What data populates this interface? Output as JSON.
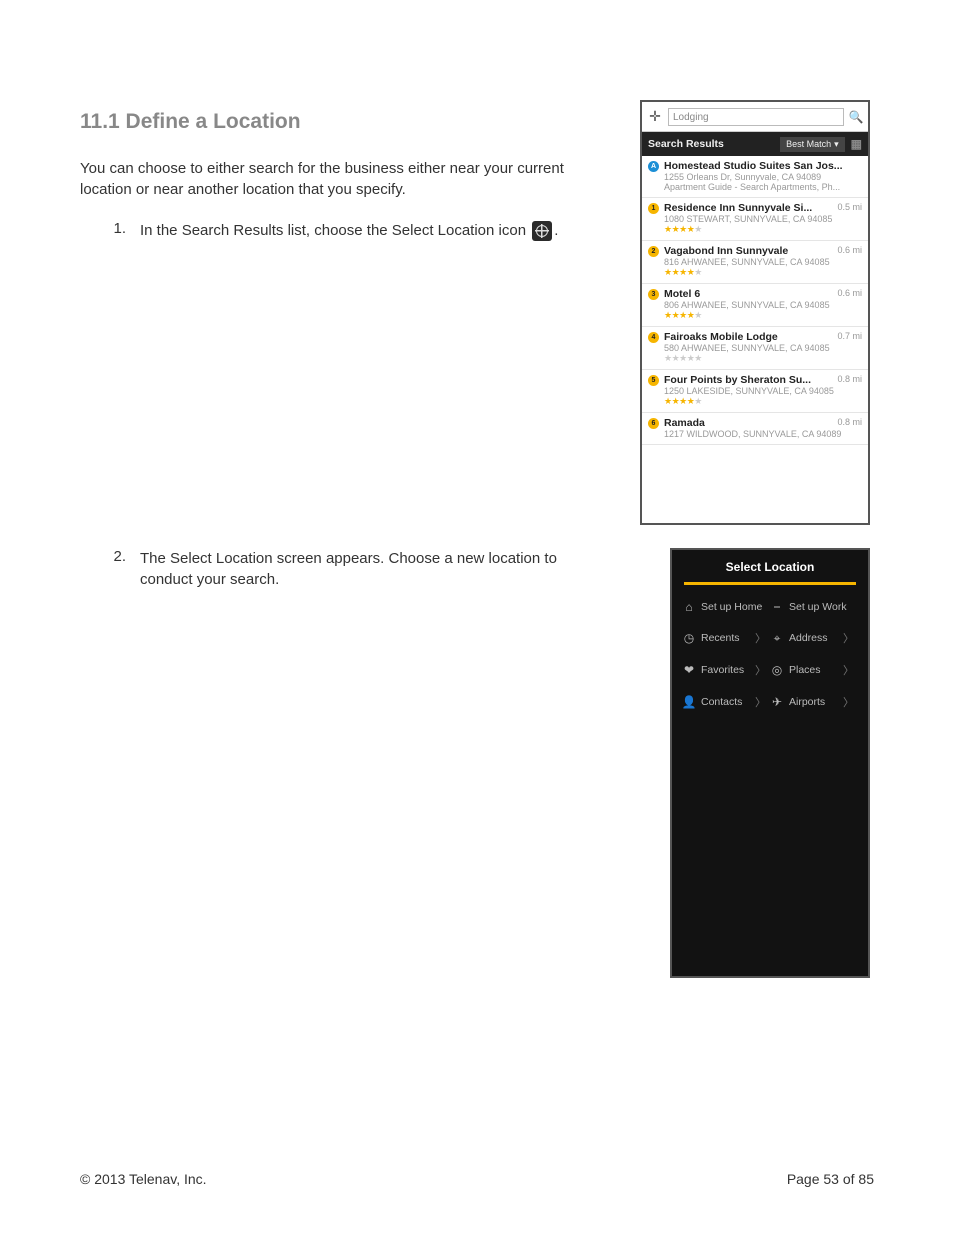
{
  "heading": "11.1 Define a Location",
  "intro": "You can choose to either search for the business either near your current location or near another location that you specify.",
  "steps": {
    "s1_num": "1.",
    "s1_text_a": "In the Search Results list, choose the Select Location icon ",
    "s1_text_b": ".",
    "s2_num": "2.",
    "s2_text": "The Select Location screen appears. Choose a new location to conduct your search."
  },
  "searchScreen": {
    "query": "Lodging",
    "header": "Search Results",
    "sort": "Best Match",
    "results": [
      {
        "badge": "A",
        "badgeClass": "blue",
        "name": "Homestead Studio Suites San Jos...",
        "dist": "",
        "addr": "1255 Orleans Dr, Sunnyvale, CA 94089",
        "extra": "Apartment Guide - Search Apartments, Ph...",
        "stars": 0,
        "grey": 0
      },
      {
        "badge": "1",
        "badgeClass": "",
        "name": "Residence Inn Sunnyvale Si...",
        "dist": "0.5 mi",
        "addr": "1080 STEWART, SUNNYVALE, CA 94085",
        "extra": "",
        "stars": 4,
        "grey": 1
      },
      {
        "badge": "2",
        "badgeClass": "",
        "name": "Vagabond Inn Sunnyvale",
        "dist": "0.6 mi",
        "addr": "816 AHWANEE, SUNNYVALE, CA 94085",
        "extra": "",
        "stars": 4,
        "grey": 1
      },
      {
        "badge": "3",
        "badgeClass": "",
        "name": "Motel 6",
        "dist": "0.6 mi",
        "addr": "806 AHWANEE, SUNNYVALE, CA 94085",
        "extra": "",
        "stars": 4,
        "grey": 1
      },
      {
        "badge": "4",
        "badgeClass": "",
        "name": "Fairoaks Mobile Lodge",
        "dist": "0.7 mi",
        "addr": "580 AHWANEE, SUNNYVALE, CA 94085",
        "extra": "",
        "stars": 0,
        "grey": 5
      },
      {
        "badge": "5",
        "badgeClass": "",
        "name": "Four Points by Sheraton Su...",
        "dist": "0.8 mi",
        "addr": "1250 LAKESIDE, SUNNYVALE, CA 94085",
        "extra": "",
        "stars": 4,
        "grey": 1
      },
      {
        "badge": "6",
        "badgeClass": "",
        "name": "Ramada",
        "dist": "0.8 mi",
        "addr": "1217 WILDWOOD, SUNNYVALE, CA 94089",
        "extra": "",
        "stars": 0,
        "grey": 0
      }
    ]
  },
  "selectLocation": {
    "title": "Select Location",
    "items": [
      {
        "icon": "⌂",
        "label": "Set up Home",
        "chev": false
      },
      {
        "icon": "⎯",
        "label": "Set up Work",
        "chev": false
      },
      {
        "icon": "◷",
        "label": "Recents",
        "chev": true
      },
      {
        "icon": "⌖",
        "label": "Address",
        "chev": true
      },
      {
        "icon": "❤",
        "label": "Favorites",
        "chev": true
      },
      {
        "icon": "◎",
        "label": "Places",
        "chev": true
      },
      {
        "icon": "👤",
        "label": "Contacts",
        "chev": true
      },
      {
        "icon": "✈",
        "label": "Airports",
        "chev": true
      }
    ]
  },
  "footer": {
    "copyright": "© 2013 Telenav, Inc.",
    "page": "Page 53 of 85"
  }
}
